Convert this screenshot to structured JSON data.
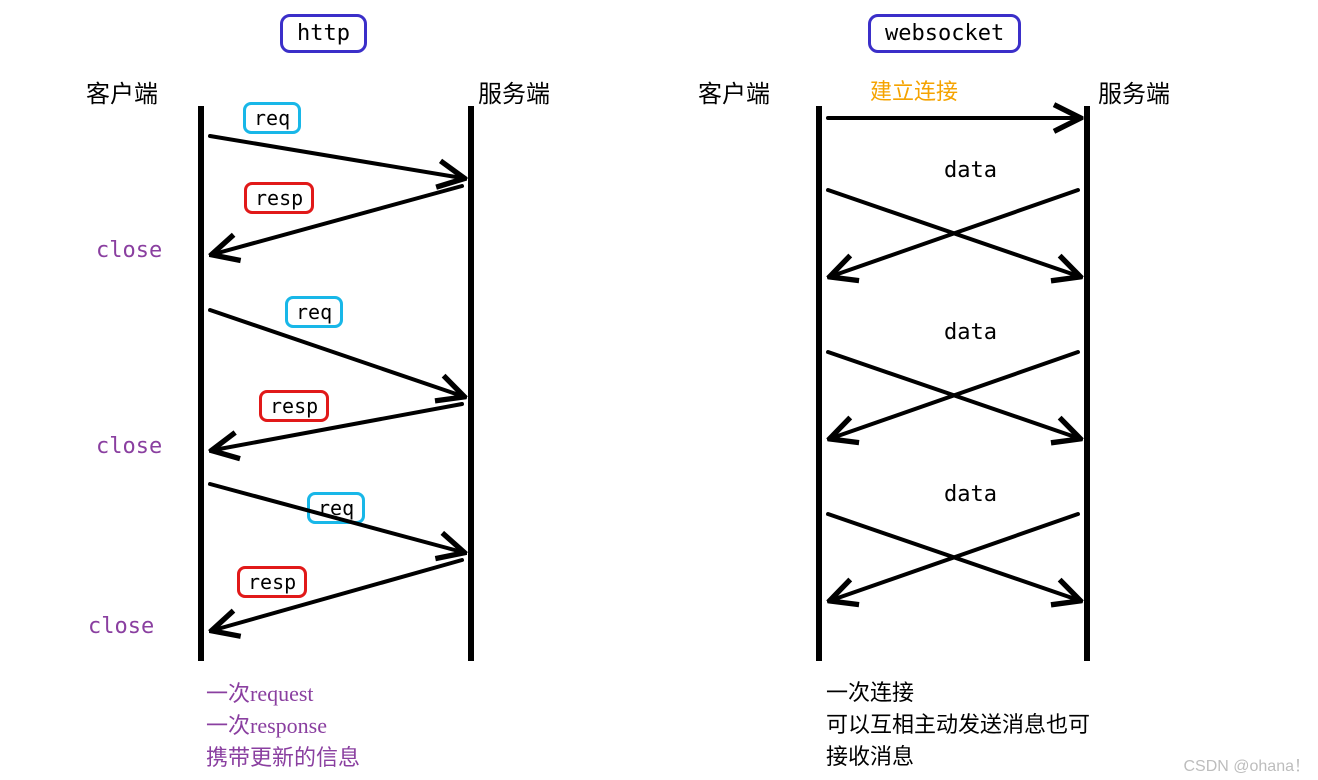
{
  "http": {
    "title": "http",
    "client_label": "客户端",
    "server_label": "服务端",
    "req_label": "req",
    "resp_label": "resp",
    "close_label": "close",
    "note_line1": "一次request",
    "note_line2": "一次response",
    "note_line3": "携带更新的信息"
  },
  "ws": {
    "title": "websocket",
    "client_label": "客户端",
    "server_label": "服务端",
    "connect_label": "建立连接",
    "data_label": "data",
    "note_line1": "一次连接",
    "note_line2": "可以互相主动发送消息也可",
    "note_line3": "接收消息"
  },
  "watermark": "CSDN @ohana！"
}
